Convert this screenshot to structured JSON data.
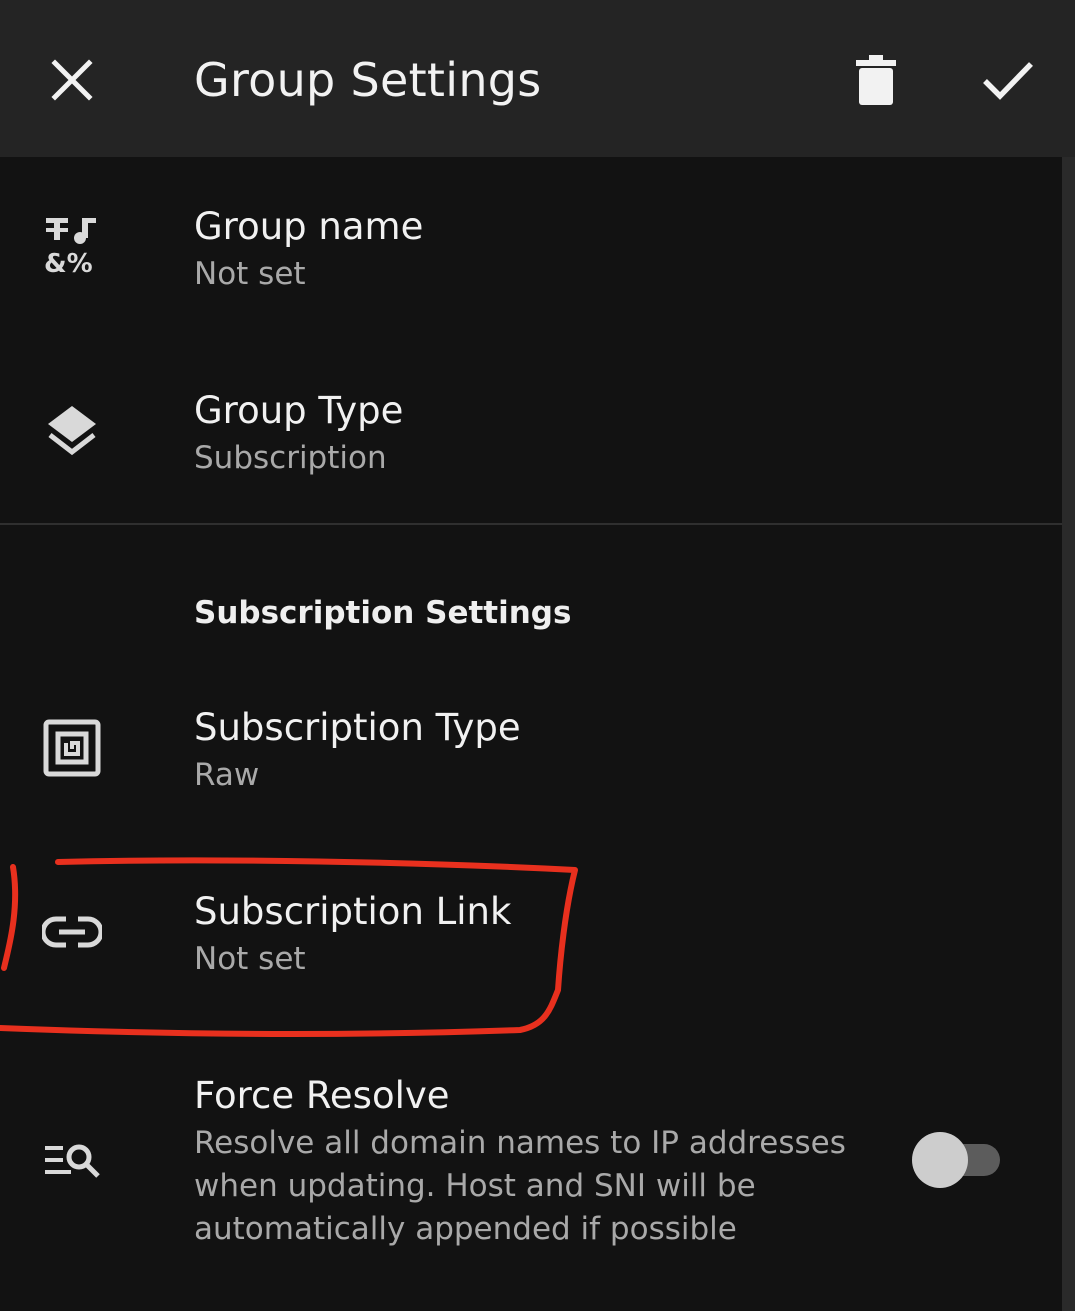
{
  "appbar": {
    "title": "Group Settings",
    "icons": {
      "close": "close-icon",
      "delete": "trash-icon",
      "confirm": "check-icon"
    }
  },
  "preferences": {
    "group_name": {
      "title": "Group name",
      "summary": "Not set",
      "icon": "text-format-icon"
    },
    "group_type": {
      "title": "Group Type",
      "summary": "Subscription",
      "icon": "layers-icon"
    },
    "category": "Subscription Settings",
    "subscription_type": {
      "title": "Subscription Type",
      "summary": "Raw",
      "icon": "nfc-box-icon"
    },
    "subscription_link": {
      "title": "Subscription Link",
      "summary": "Not set",
      "icon": "link-icon"
    },
    "force_resolve": {
      "title": "Force Resolve",
      "summary": "Resolve all domain names to IP addresses when updating. Host and SNI will be automatically appended if possible",
      "icon": "find-in-list-icon",
      "enabled": false
    }
  },
  "colors": {
    "background": "#121212",
    "appbar": "#242424",
    "highlight_annotation": "#e8301e"
  }
}
